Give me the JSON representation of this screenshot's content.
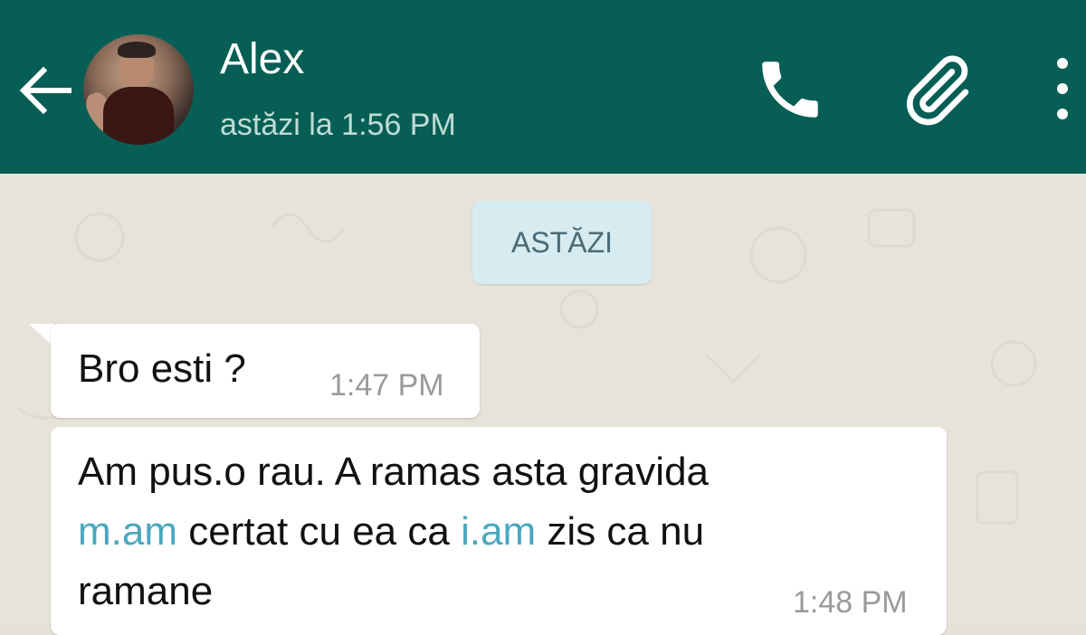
{
  "header": {
    "contact_name": "Alex",
    "last_seen": "astăzi la 1:56 PM",
    "background_color": "#075e54",
    "icons": [
      "arrow-left-icon",
      "avatar",
      "phone-icon",
      "paperclip-icon",
      "more-vert-icon"
    ]
  },
  "chat": {
    "date_divider": "ASTĂZI",
    "messages": [
      {
        "text": "Bro esti ?",
        "time": "1:47 PM"
      },
      {
        "line1": "Am pus.o rau. A ramas asta gravida",
        "line2_link1": "m.am",
        "line2_mid": " certat cu ea ca ",
        "line2_link2": "i.am",
        "line2_end": " zis ca nu",
        "line3": "ramane",
        "time": "1:48 PM"
      }
    ],
    "link_color": "#4aa7bf"
  }
}
